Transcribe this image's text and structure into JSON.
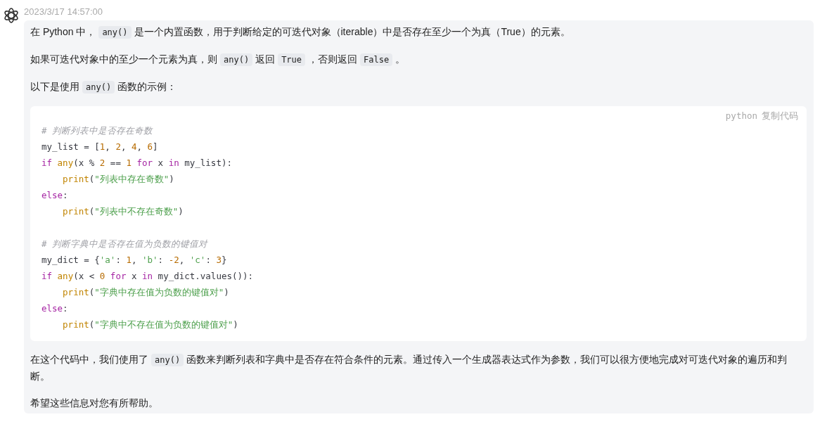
{
  "message": {
    "timestamp": "2023/3/17 14:57:00",
    "paragraphs_before": [
      [
        {
          "kind": "text",
          "s": "在 Python 中，"
        },
        {
          "kind": "code",
          "s": "any()"
        },
        {
          "kind": "text",
          "s": "是一个内置函数，用于判断给定的可迭代对象（iterable）中是否存在至少一个为真（True）的元素。"
        }
      ],
      [
        {
          "kind": "text",
          "s": "如果可迭代对象中的至少一个元素为真，则"
        },
        {
          "kind": "code",
          "s": "any()"
        },
        {
          "kind": "text",
          "s": "返回"
        },
        {
          "kind": "code",
          "s": "True"
        },
        {
          "kind": "text",
          "s": "，否则返回"
        },
        {
          "kind": "code",
          "s": "False"
        },
        {
          "kind": "text",
          "s": "。"
        }
      ],
      [
        {
          "kind": "text",
          "s": "以下是使用"
        },
        {
          "kind": "code",
          "s": "any()"
        },
        {
          "kind": "text",
          "s": "函数的示例："
        }
      ]
    ],
    "code_block": {
      "language": "python",
      "copy_label": "复制代码",
      "lines": [
        {
          "indent": false,
          "blank_before": false,
          "tokens": [
            {
              "kind": "comment",
              "s": "# 判断列表中是否存在奇数"
            }
          ]
        },
        {
          "indent": false,
          "blank_before": false,
          "tokens": [
            {
              "kind": "plain",
              "s": "my_list = ["
            },
            {
              "kind": "number",
              "s": "1"
            },
            {
              "kind": "plain",
              "s": ", "
            },
            {
              "kind": "number",
              "s": "2"
            },
            {
              "kind": "plain",
              "s": ", "
            },
            {
              "kind": "number",
              "s": "4"
            },
            {
              "kind": "plain",
              "s": ", "
            },
            {
              "kind": "number",
              "s": "6"
            },
            {
              "kind": "plain",
              "s": "]"
            }
          ]
        },
        {
          "indent": false,
          "blank_before": false,
          "tokens": [
            {
              "kind": "keyword",
              "s": "if "
            },
            {
              "kind": "builtin",
              "s": "any"
            },
            {
              "kind": "plain",
              "s": "(x % "
            },
            {
              "kind": "number",
              "s": "2"
            },
            {
              "kind": "plain",
              "s": " == "
            },
            {
              "kind": "number",
              "s": "1"
            },
            {
              "kind": "keyword",
              "s": " for"
            },
            {
              "kind": "plain",
              "s": " x "
            },
            {
              "kind": "keyword",
              "s": "in"
            },
            {
              "kind": "plain",
              "s": " my_list):"
            }
          ]
        },
        {
          "indent": true,
          "blank_before": false,
          "tokens": [
            {
              "kind": "builtin",
              "s": "print"
            },
            {
              "kind": "plain",
              "s": "("
            },
            {
              "kind": "string",
              "s": "\"列表中存在奇数\""
            },
            {
              "kind": "plain",
              "s": ")"
            }
          ]
        },
        {
          "indent": false,
          "blank_before": false,
          "tokens": [
            {
              "kind": "keyword",
              "s": "else"
            },
            {
              "kind": "plain",
              "s": ":"
            }
          ]
        },
        {
          "indent": true,
          "blank_before": false,
          "tokens": [
            {
              "kind": "builtin",
              "s": "print"
            },
            {
              "kind": "plain",
              "s": "("
            },
            {
              "kind": "string",
              "s": "\"列表中不存在奇数\""
            },
            {
              "kind": "plain",
              "s": ")"
            }
          ]
        },
        {
          "indent": false,
          "blank_before": true,
          "tokens": [
            {
              "kind": "comment",
              "s": "# 判断字典中是否存在值为负数的键值对"
            }
          ]
        },
        {
          "indent": false,
          "blank_before": false,
          "tokens": [
            {
              "kind": "plain",
              "s": "my_dict = {"
            },
            {
              "kind": "string",
              "s": "'a'"
            },
            {
              "kind": "plain",
              "s": ": "
            },
            {
              "kind": "number",
              "s": "1"
            },
            {
              "kind": "plain",
              "s": ", "
            },
            {
              "kind": "string",
              "s": "'b'"
            },
            {
              "kind": "plain",
              "s": ": "
            },
            {
              "kind": "number",
              "s": "-2"
            },
            {
              "kind": "plain",
              "s": ", "
            },
            {
              "kind": "string",
              "s": "'c'"
            },
            {
              "kind": "plain",
              "s": ": "
            },
            {
              "kind": "number",
              "s": "3"
            },
            {
              "kind": "plain",
              "s": "}"
            }
          ]
        },
        {
          "indent": false,
          "blank_before": false,
          "tokens": [
            {
              "kind": "keyword",
              "s": "if "
            },
            {
              "kind": "builtin",
              "s": "any"
            },
            {
              "kind": "plain",
              "s": "(x < "
            },
            {
              "kind": "number",
              "s": "0"
            },
            {
              "kind": "keyword",
              "s": " for"
            },
            {
              "kind": "plain",
              "s": " x "
            },
            {
              "kind": "keyword",
              "s": "in"
            },
            {
              "kind": "plain",
              "s": " my_dict.values()):"
            }
          ]
        },
        {
          "indent": true,
          "blank_before": false,
          "tokens": [
            {
              "kind": "builtin",
              "s": "print"
            },
            {
              "kind": "plain",
              "s": "("
            },
            {
              "kind": "string",
              "s": "\"字典中存在值为负数的键值对\""
            },
            {
              "kind": "plain",
              "s": ")"
            }
          ]
        },
        {
          "indent": false,
          "blank_before": false,
          "tokens": [
            {
              "kind": "keyword",
              "s": "else"
            },
            {
              "kind": "plain",
              "s": ":"
            }
          ]
        },
        {
          "indent": true,
          "blank_before": false,
          "tokens": [
            {
              "kind": "builtin",
              "s": "print"
            },
            {
              "kind": "plain",
              "s": "("
            },
            {
              "kind": "string",
              "s": "\"字典中不存在值为负数的键值对\""
            },
            {
              "kind": "plain",
              "s": ")"
            }
          ]
        }
      ]
    },
    "paragraphs_after": [
      [
        {
          "kind": "text",
          "s": "在这个代码中，我们使用了"
        },
        {
          "kind": "code",
          "s": "any()"
        },
        {
          "kind": "text",
          "s": "函数来判断列表和字典中是否存在符合条件的元素。通过传入一个生成器表达式作为参数，我们可以很方便地完成对可迭代对象的遍历和判断。"
        }
      ],
      [
        {
          "kind": "text",
          "s": "希望这些信息对您有所帮助。"
        }
      ]
    ]
  }
}
